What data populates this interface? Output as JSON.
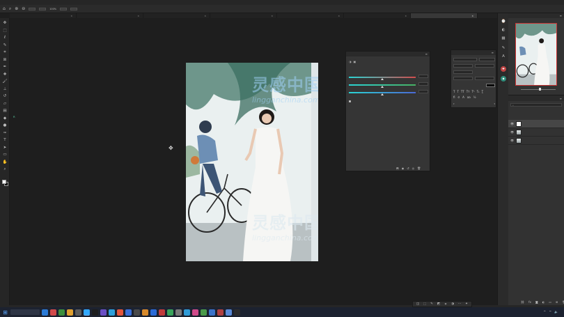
{
  "app": {
    "menu": [
      "",
      "",
      "",
      "",
      "",
      "",
      "",
      "",
      "",
      "",
      "",
      "",
      ""
    ]
  },
  "options_bar": {
    "zoom": "100%",
    "buttons": [
      "",
      "",
      "",
      ""
    ]
  },
  "document_tabs": [
    {
      "label": "",
      "active": false
    },
    {
      "label": "",
      "active": false
    },
    {
      "label": "",
      "active": false
    },
    {
      "label": "",
      "active": false
    },
    {
      "label": "",
      "active": false
    },
    {
      "label": "",
      "active": false
    },
    {
      "label": "",
      "active": true
    }
  ],
  "tools": [
    "move-tool",
    "marquee-tool",
    "lasso-tool",
    "quick-select-tool",
    "crop-tool",
    "frame-tool",
    "eyedropper-tool",
    "spot-heal-tool",
    "brush-tool",
    "stamp-tool",
    "history-brush-tool",
    "eraser-tool",
    "gradient-tool",
    "blur-tool",
    "dodge-tool",
    "pen-tool",
    "text-tool",
    "path-select-tool",
    "shape-tool",
    "hand-tool",
    "zoom-tool"
  ],
  "info_readout": {
    "rows": [
      [
        {
          "label": "R",
          "value": ""
        },
        {
          "label": "",
          "value": ""
        },
        {
          "label": "",
          "value": ""
        }
      ],
      [
        {
          "label": "",
          "value": ""
        },
        {
          "label": "",
          "value": ""
        },
        {
          "label": "",
          "value": ""
        }
      ],
      [
        {
          "label": "",
          "value": ""
        },
        {
          "label": "",
          "value": ""
        },
        {
          "label": "",
          "value": ""
        }
      ]
    ]
  },
  "properties_panel": {
    "tabs": [
      "",
      ""
    ],
    "adjustment_title": "",
    "preset_label": "",
    "sliders": [
      {
        "left_label": "",
        "right_label": "",
        "value_text": "",
        "position": 0.5,
        "color": "#d24c4c"
      },
      {
        "left_label": "",
        "right_label": "",
        "value_text": "",
        "position": 0.5,
        "color": "#47b062"
      },
      {
        "left_label": "",
        "right_label": "",
        "value_text": "",
        "position": 0.5,
        "color": "#4b69d6"
      }
    ],
    "checkbox_label": ""
  },
  "character_panel": {
    "tabs": [
      "",
      ""
    ],
    "font_family": "",
    "font_style": "",
    "size": "",
    "leading": "",
    "tracking": "",
    "scale_v": "",
    "scale_h": "",
    "color_label": ""
  },
  "navigator_panel": {
    "zoom": ""
  },
  "layers_panel": {
    "opacity": "",
    "fill": "",
    "blend_mode": "",
    "layers": [
      {
        "name": "",
        "type": "adjustment",
        "selected": true
      },
      {
        "name": "",
        "type": "photo",
        "selected": false
      },
      {
        "name": "",
        "type": "photo",
        "selected": false
      }
    ]
  },
  "watermark": {
    "brand_cn": "灵感中国",
    "brand_url": "lingganchina.com"
  },
  "subtitle": "",
  "status": {
    "zoom": ""
  },
  "taskbar": {
    "clock_time": "",
    "clock_date": "",
    "app_colors": [
      "#2b7bd6",
      "#d14a4a",
      "#3c8f3c",
      "#e0a030",
      "#5b5b5b",
      "#31a8ff",
      "#1d1d1d",
      "#6a4fc4",
      "#2d9fd9",
      "#e3553b",
      "#3a6fd8",
      "#4a4a4a",
      "#d88a2b",
      "#2b6bd6",
      "#c03b3b",
      "#39a35b",
      "#7a7a7a",
      "#2f9bd6",
      "#d04a8a",
      "#4a9a4a",
      "#3b73c9",
      "#b04040",
      "#5a8ad6",
      "#2c2c2c"
    ]
  },
  "colors": {
    "accent": "#31a8ff",
    "watermark": "#9fd0f5",
    "info_text": "#5bd1a4"
  }
}
